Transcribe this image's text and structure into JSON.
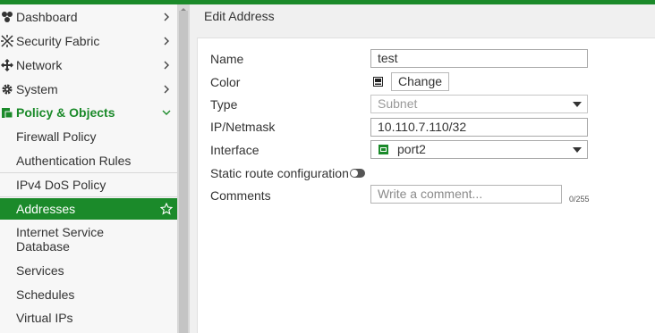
{
  "sidebar": {
    "items": [
      {
        "label": "Dashboard",
        "icon": "dashboard-icon"
      },
      {
        "label": "Security Fabric",
        "icon": "security-fabric-icon"
      },
      {
        "label": "Network",
        "icon": "network-icon"
      },
      {
        "label": "System",
        "icon": "gear-icon"
      },
      {
        "label": "Policy & Objects",
        "icon": "policy-objects-icon"
      }
    ],
    "subitems": [
      {
        "label": "Firewall Policy"
      },
      {
        "label": "Authentication Rules"
      },
      {
        "label": "IPv4 DoS Policy"
      },
      {
        "label": "Addresses"
      },
      {
        "label": "Internet Service"
      },
      {
        "label": "Database"
      },
      {
        "label": "Services"
      },
      {
        "label": "Schedules"
      },
      {
        "label": "Virtual IPs"
      }
    ]
  },
  "main": {
    "title": "Edit Address",
    "form": {
      "name_label": "Name",
      "name_value": "test",
      "color_label": "Color",
      "change_button": "Change",
      "type_label": "Type",
      "type_value": "Subnet",
      "ip_label": "IP/Netmask",
      "ip_value": "10.110.7.110/32",
      "interface_label": "Interface",
      "interface_value": "port2",
      "static_route_label": "Static route configuration",
      "comments_label": "Comments",
      "comments_placeholder": "Write a comment...",
      "comments_counter": "0/255"
    }
  },
  "colors": {
    "accent": "#1b8a2a",
    "selected_text": "#ffffff"
  }
}
